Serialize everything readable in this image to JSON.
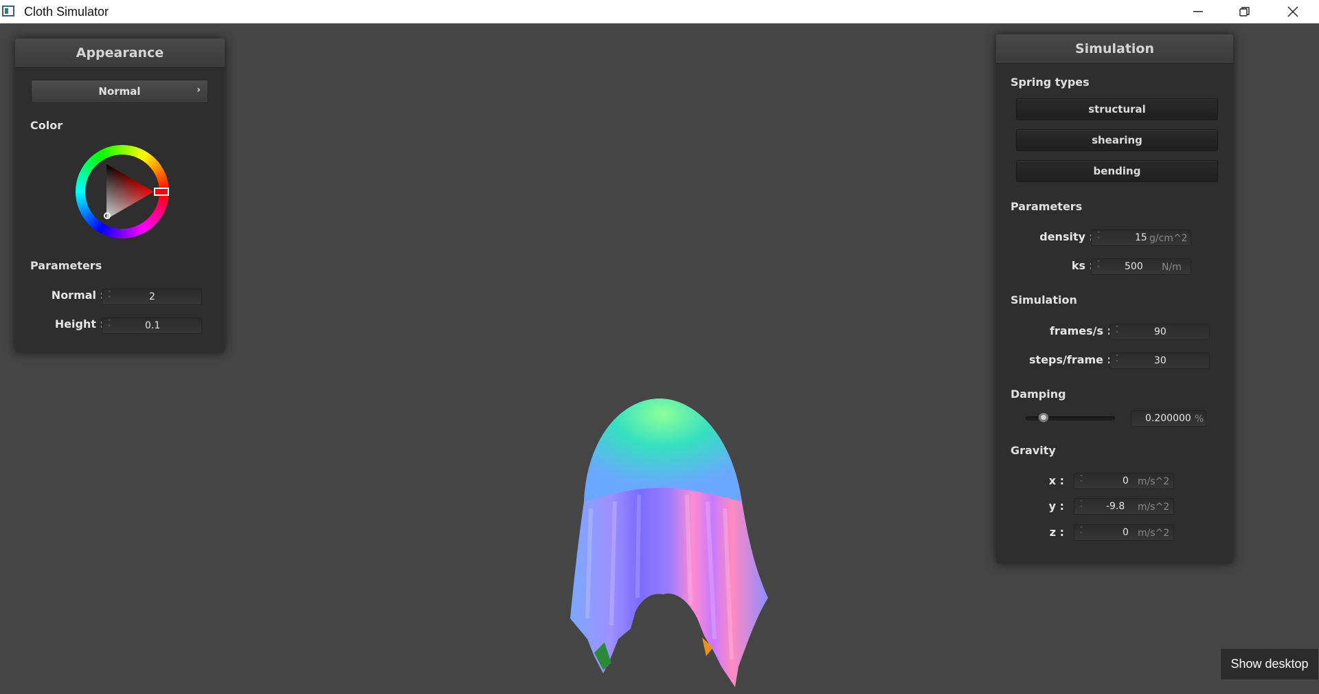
{
  "window": {
    "title": "Cloth Simulator",
    "controls": [
      "minimize",
      "restore",
      "close"
    ]
  },
  "appearance": {
    "header": "Appearance",
    "shader_dropdown": "Normal",
    "color_label": "Color",
    "color_value": "#ff0000",
    "parameters_label": "Parameters",
    "params": [
      {
        "label": "Normal :",
        "value": "2"
      },
      {
        "label": "Height :",
        "value": "0.1"
      }
    ]
  },
  "simulation_panel": {
    "header": "Simulation",
    "spring_types_label": "Spring types",
    "spring_buttons": [
      "structural",
      "shearing",
      "bending"
    ],
    "parameters_label": "Parameters",
    "params": [
      {
        "label": "density :",
        "value": "15",
        "unit": "g/cm^2"
      },
      {
        "label": "ks :",
        "value": "500",
        "unit": "N/m"
      }
    ],
    "simulation_label": "Simulation",
    "sim_params": [
      {
        "label": "frames/s :",
        "value": "90"
      },
      {
        "label": "steps/frame :",
        "value": "30"
      }
    ],
    "damping_label": "Damping",
    "damping_value": "0.200000",
    "damping_unit": "%",
    "damping_slider_fraction": 0.2,
    "gravity_label": "Gravity",
    "gravity": [
      {
        "label": "x :",
        "value": "0",
        "unit": "m/s^2"
      },
      {
        "label": "y :",
        "value": "-9.8",
        "unit": "m/s^2"
      },
      {
        "label": "z :",
        "value": "0",
        "unit": "m/s^2"
      }
    ]
  },
  "tooltip": {
    "text": "Show desktop"
  },
  "colors": {
    "background": "#454545",
    "panel": "#2e2e2e",
    "accent": "#ff0000"
  }
}
